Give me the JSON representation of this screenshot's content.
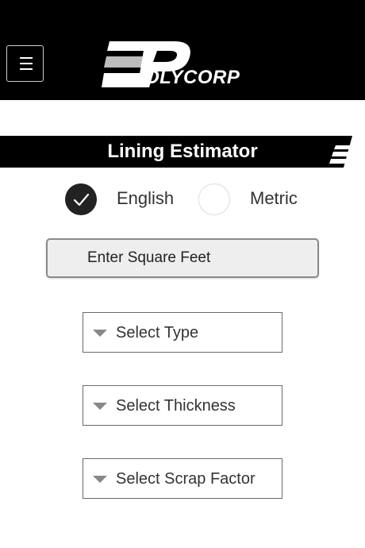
{
  "header": {
    "menu_icon": "hamburger-menu-icon",
    "logo_text": "OLYCORP",
    "background": "#000000"
  },
  "estimator": {
    "title": "Lining Estimator",
    "units": [
      {
        "label": "English",
        "checked": true
      },
      {
        "label": "Metric",
        "checked": false
      }
    ],
    "square_feet": {
      "placeholder": "Enter Square Feet",
      "value": ""
    },
    "selects": [
      {
        "label": "Select Type"
      },
      {
        "label": "Select Thickness"
      },
      {
        "label": "Select Scrap Factor"
      }
    ]
  }
}
